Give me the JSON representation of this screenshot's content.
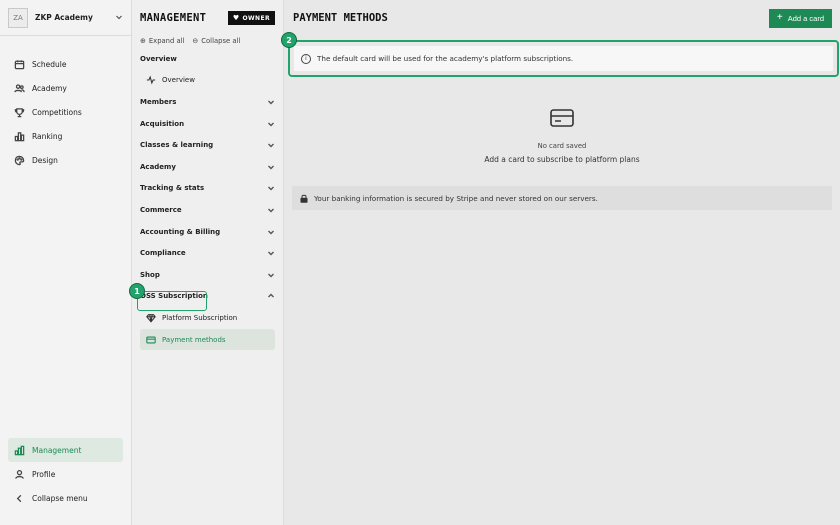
{
  "org": {
    "initials": "ZA",
    "name": "ZKP Academy"
  },
  "rail": {
    "items": [
      {
        "label": "Schedule",
        "icon": "calendar-icon"
      },
      {
        "label": "Academy",
        "icon": "users-icon"
      },
      {
        "label": "Competitions",
        "icon": "trophy-icon"
      },
      {
        "label": "Ranking",
        "icon": "bar-chart-icon"
      },
      {
        "label": "Design",
        "icon": "palette-icon"
      }
    ],
    "bottom": [
      {
        "label": "Management",
        "icon": "management-icon",
        "active": true
      },
      {
        "label": "Profile",
        "icon": "user-icon"
      },
      {
        "label": "Collapse menu",
        "icon": "chevron-left-icon"
      }
    ]
  },
  "management": {
    "title": "MANAGEMENT",
    "badge": "OWNER",
    "expand_all": "Expand all",
    "collapse_all": "Collapse all",
    "overview_section": "Overview",
    "overview_item": "Overview",
    "sections": [
      "Members",
      "Acquisition",
      "Classes & learning",
      "Academy",
      "Tracking & stats",
      "Commerce",
      "Accounting & Billing",
      "Compliance",
      "Shop"
    ],
    "oss_section": "OSS Subscription",
    "oss_items": [
      {
        "label": "Platform Subscription",
        "icon": "diamond-icon"
      },
      {
        "label": "Payment methods",
        "icon": "credit-card-icon",
        "active": true
      }
    ]
  },
  "main": {
    "title": "PAYMENT METHODS",
    "add_button": "Add a card",
    "info_text": "The default card will be used for the academy's platform subscriptions.",
    "empty_title": "No card saved",
    "empty_subtitle": "Add a card to subscribe to platform plans",
    "secure_text": "Your banking information is secured by Stripe and never stored on our servers."
  },
  "markers": {
    "one": "1",
    "two": "2"
  },
  "colors": {
    "accent": "#1d8a55",
    "highlight": "#22a36b"
  }
}
